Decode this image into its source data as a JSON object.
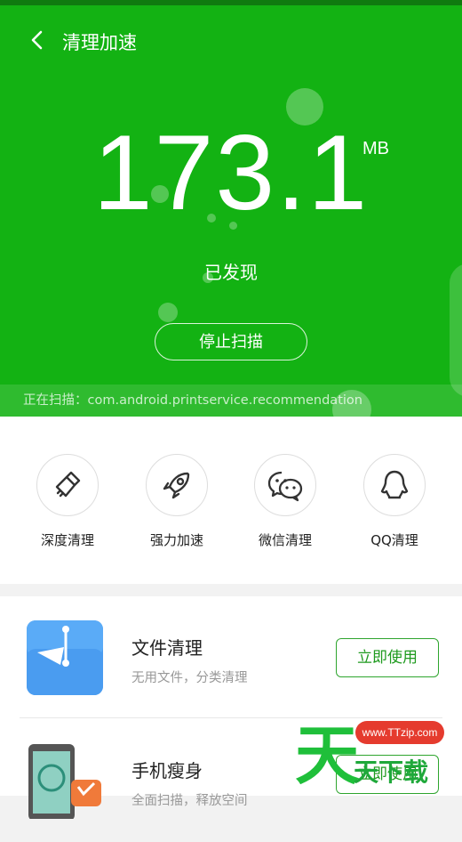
{
  "header": {
    "title": "清理加速"
  },
  "scan": {
    "amount": "173.1",
    "unit": "MB",
    "status_label": "已发现",
    "stop_label": "停止扫描",
    "current": "正在扫描：com.android.printservice.recommendation"
  },
  "tools": [
    {
      "label": "深度清理",
      "icon": "broom-icon"
    },
    {
      "label": "强力加速",
      "icon": "rocket-icon"
    },
    {
      "label": "微信清理",
      "icon": "wechat-icon"
    },
    {
      "label": "QQ清理",
      "icon": "qq-penguin-icon"
    }
  ],
  "cards": [
    {
      "name": "文件清理",
      "desc": "无用文件，分类清理",
      "button": "立即使用",
      "icon": "file-folder-icon"
    },
    {
      "name": "手机瘦身",
      "desc": "全面扫描，释放空间",
      "button": "立即使用",
      "icon": "phone-slim-icon"
    }
  ],
  "watermark": {
    "url": "www.TTzip.com",
    "text": "天下载"
  },
  "colors": {
    "primary_green": "#13b213",
    "button_green": "#1e9a1e",
    "card_blue": "#4a9cf0"
  }
}
